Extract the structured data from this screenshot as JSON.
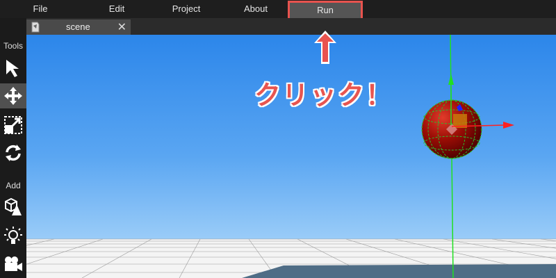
{
  "menu": {
    "file": "File",
    "edit": "Edit",
    "project": "Project",
    "about": "About",
    "run": "Run"
  },
  "tab": {
    "label": "scene",
    "close": "✕"
  },
  "toolbar": {
    "tools_heading": "Tools",
    "add_heading": "Add",
    "tools": [
      "select-arrow-icon",
      "move-icon",
      "scale-icon",
      "rotate-icon"
    ],
    "add": [
      "add-object-icon",
      "add-light-icon",
      "add-camera-icon"
    ]
  },
  "annotation": {
    "arrow": "↑",
    "text": "クリック！"
  },
  "colors": {
    "annotation": "#e8534e",
    "sky_top": "#2c86ea",
    "sphere": "#8b0000",
    "axis_x": "#ff2020",
    "axis_y": "#20e020",
    "axis_z": "#2020ff"
  }
}
